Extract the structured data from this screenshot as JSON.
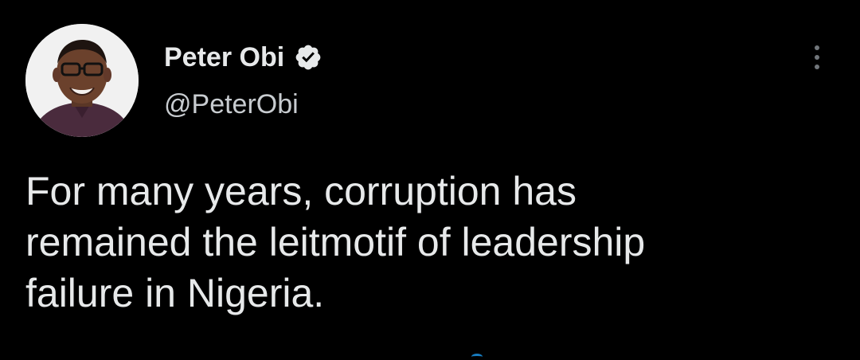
{
  "author": {
    "name": "Peter Obi",
    "handle": "@PeterObi",
    "verified": true,
    "avatar_icon": "profile-photo"
  },
  "tweet": {
    "text": "For many years, corruption has\nremained the leitmotif of leadership\nfailure in Nigeria."
  },
  "actions": {
    "more_icon": "more-vertical-icon"
  },
  "colors": {
    "background": "#000000",
    "text": "#e7e9ea",
    "secondary_text": "#c8ccd0",
    "verified_badge": "#e7e9ea",
    "accent": "#1d9bf0"
  }
}
